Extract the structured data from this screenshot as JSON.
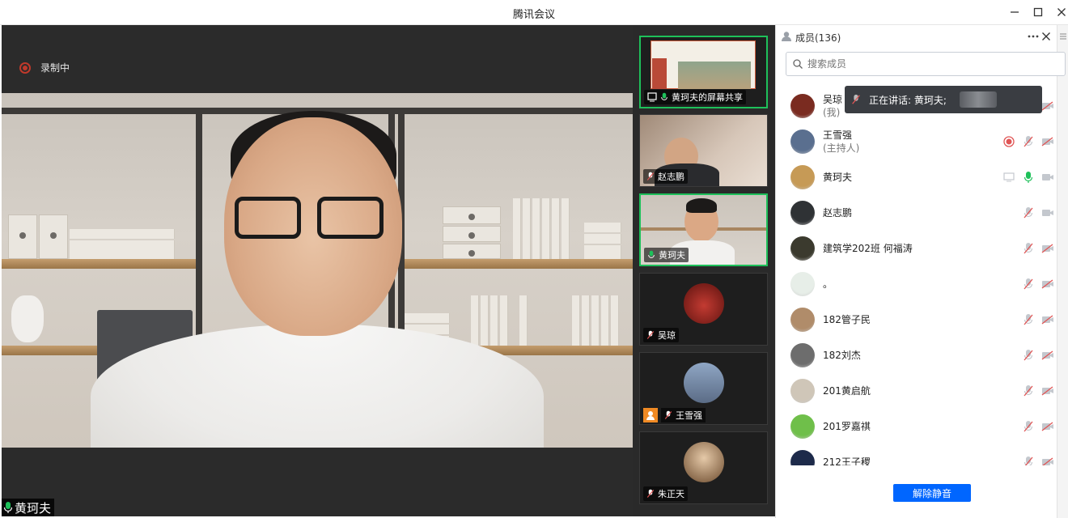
{
  "app": {
    "title": "腾讯会议"
  },
  "window_controls": {
    "minimize": "—",
    "maximize": "☐",
    "close": "✕"
  },
  "main_video": {
    "recording_label": "录制中",
    "speaker_name": "黄珂夫"
  },
  "thumbnails": [
    {
      "name": "黄珂夫的屏幕共享",
      "mic": "on",
      "kind": "screen-share"
    },
    {
      "name": "赵志鹏",
      "mic": "muted",
      "kind": "video"
    },
    {
      "name": "黄珂夫",
      "mic": "on",
      "kind": "video"
    },
    {
      "name": "吴琼",
      "mic": "muted",
      "kind": "avatar"
    },
    {
      "name": "王雪强",
      "mic": "muted",
      "kind": "avatar",
      "host": true
    },
    {
      "name": "朱正天",
      "mic": "muted",
      "kind": "avatar"
    }
  ],
  "panel": {
    "title": "成员(136)",
    "search_placeholder": "搜索成员",
    "unmute_all": "解除静音"
  },
  "toast": {
    "text": "正在讲话: 黄珂夫;"
  },
  "members": [
    {
      "name": "吴琼",
      "sub": "(我)",
      "avatar_color": "#7a2b20"
    },
    {
      "name": "王雪强",
      "sub": "(主持人)",
      "avatar_color": "#5a6f8f",
      "recording": true
    },
    {
      "name": "黄珂夫",
      "sub": "",
      "avatar_color": "#c69a56",
      "sharing": true,
      "mic": "on"
    },
    {
      "name": "赵志鹏",
      "sub": "",
      "avatar_color": "#2f3235"
    },
    {
      "name": "建筑学202班 何福涛",
      "sub": "",
      "avatar_color": "#3b3a2e"
    },
    {
      "name": "。",
      "sub": "",
      "avatar_color": "#e7eee8"
    },
    {
      "name": "182管子民",
      "sub": "",
      "avatar_color": "#b08c6a"
    },
    {
      "name": "182刘杰",
      "sub": "",
      "avatar_color": "#6d6d6d"
    },
    {
      "name": "201黄启航",
      "sub": "",
      "avatar_color": "#cfc6b8"
    },
    {
      "name": "201罗嘉祺",
      "sub": "",
      "avatar_color": "#6fbf4a"
    },
    {
      "name": "212王子稷",
      "sub": "",
      "avatar_color": "#1d2a4a"
    }
  ],
  "colors": {
    "accent": "#0066ff",
    "active_border": "#1ec05a",
    "mic_on": "#1ec05a",
    "muted": "#e05555"
  }
}
